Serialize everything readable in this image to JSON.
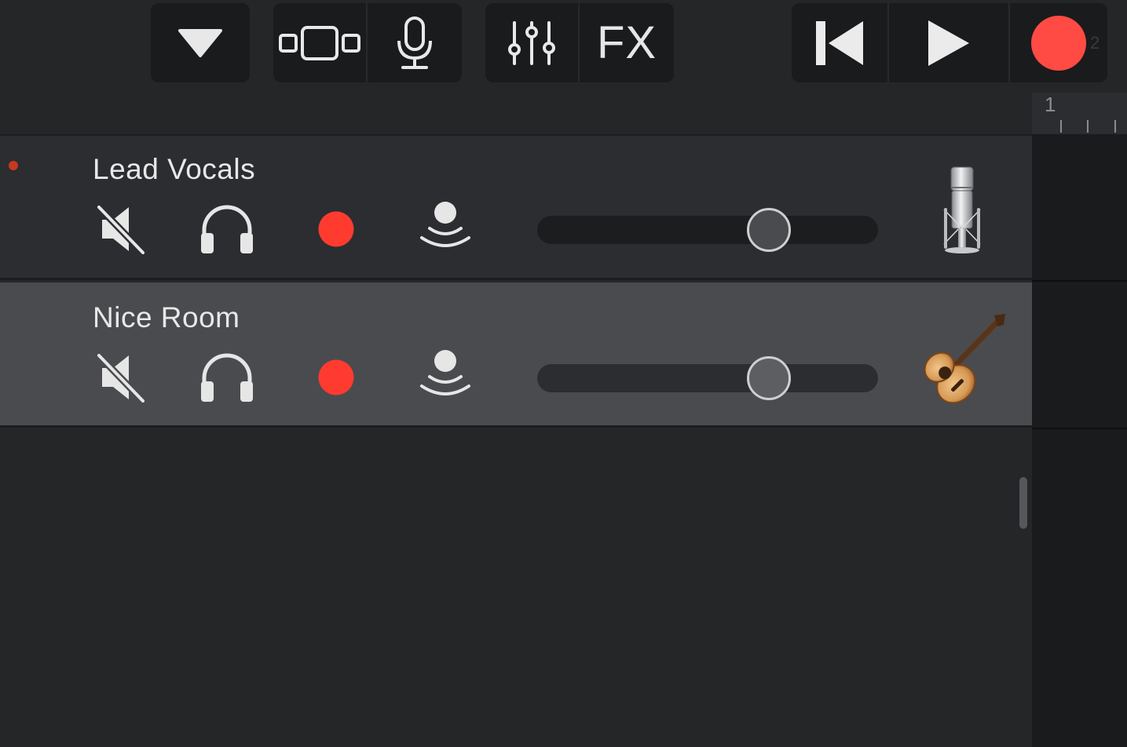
{
  "toolbar": {
    "fx_label": "FX",
    "record_color": "#ff4b43",
    "measure_hint": "2"
  },
  "ruler": {
    "bar_number": "1"
  },
  "tracks": [
    {
      "name": "Lead Vocals",
      "instrument_icon": "condenser-microphone-icon",
      "volume_fraction": 0.68,
      "armed_indicator": true
    },
    {
      "name": "Nice Room",
      "instrument_icon": "acoustic-guitar-icon",
      "volume_fraction": 0.68,
      "selected": true
    }
  ],
  "colors": {
    "background": "#242628",
    "record_red": "#ff3b30",
    "selected_track": "#4a4b4e"
  }
}
